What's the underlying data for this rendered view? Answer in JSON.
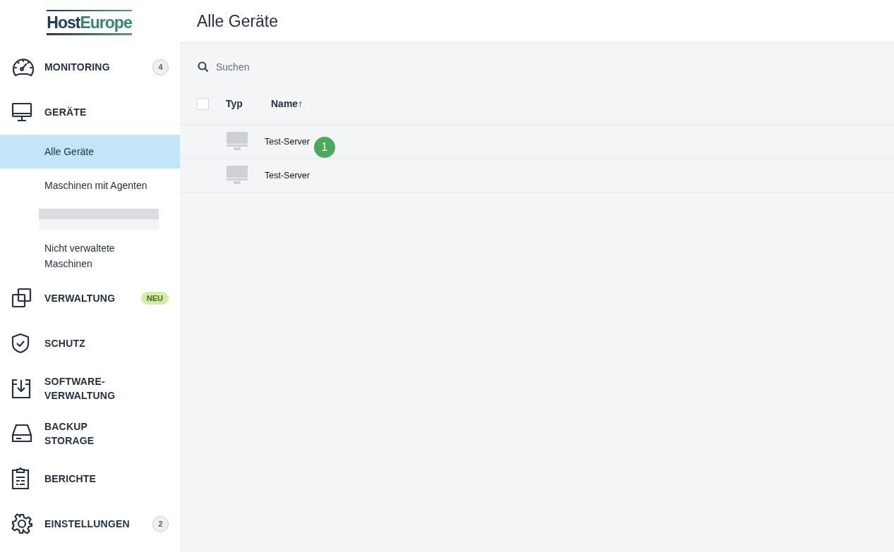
{
  "logo": {
    "part_1": "Host",
    "part_2": "Europe"
  },
  "sidebar": {
    "items": [
      {
        "label": "MONITORING",
        "badge": {
          "text": "4",
          "kind": "count"
        }
      },
      {
        "label": "GERÄTE",
        "children": [
          {
            "kind": "link",
            "label": "Alle Geräte",
            "selected": true
          },
          {
            "kind": "link",
            "label": "Maschinen mit Agenten",
            "selected": false
          },
          {
            "kind": "redacted",
            "selected": false
          },
          {
            "kind": "link",
            "label": "Nicht verwaltete Maschinen",
            "selected": false
          }
        ]
      },
      {
        "label": "VERWALTUNG",
        "badge": {
          "text": "NEU",
          "kind": "new"
        }
      },
      {
        "label": "SCHUTZ"
      },
      {
        "label": "SOFTWARE-VERWALTUNG"
      },
      {
        "label": "BACKUP STORAGE"
      },
      {
        "label": "BERICHTE"
      },
      {
        "label": "EINSTELLUNGEN",
        "badge": {
          "text": "2",
          "kind": "count"
        }
      }
    ]
  },
  "page": {
    "title": "Alle Geräte"
  },
  "search": {
    "placeholder": "Suchen"
  },
  "table": {
    "select_all": {
      "checked": false
    },
    "columns": [
      {
        "label": "Typ"
      },
      {
        "label": "Name",
        "sort": "↑"
      }
    ],
    "rows": [
      {
        "name": "Test-Server",
        "marker": "1"
      },
      {
        "name": "Test-Server"
      }
    ]
  }
}
